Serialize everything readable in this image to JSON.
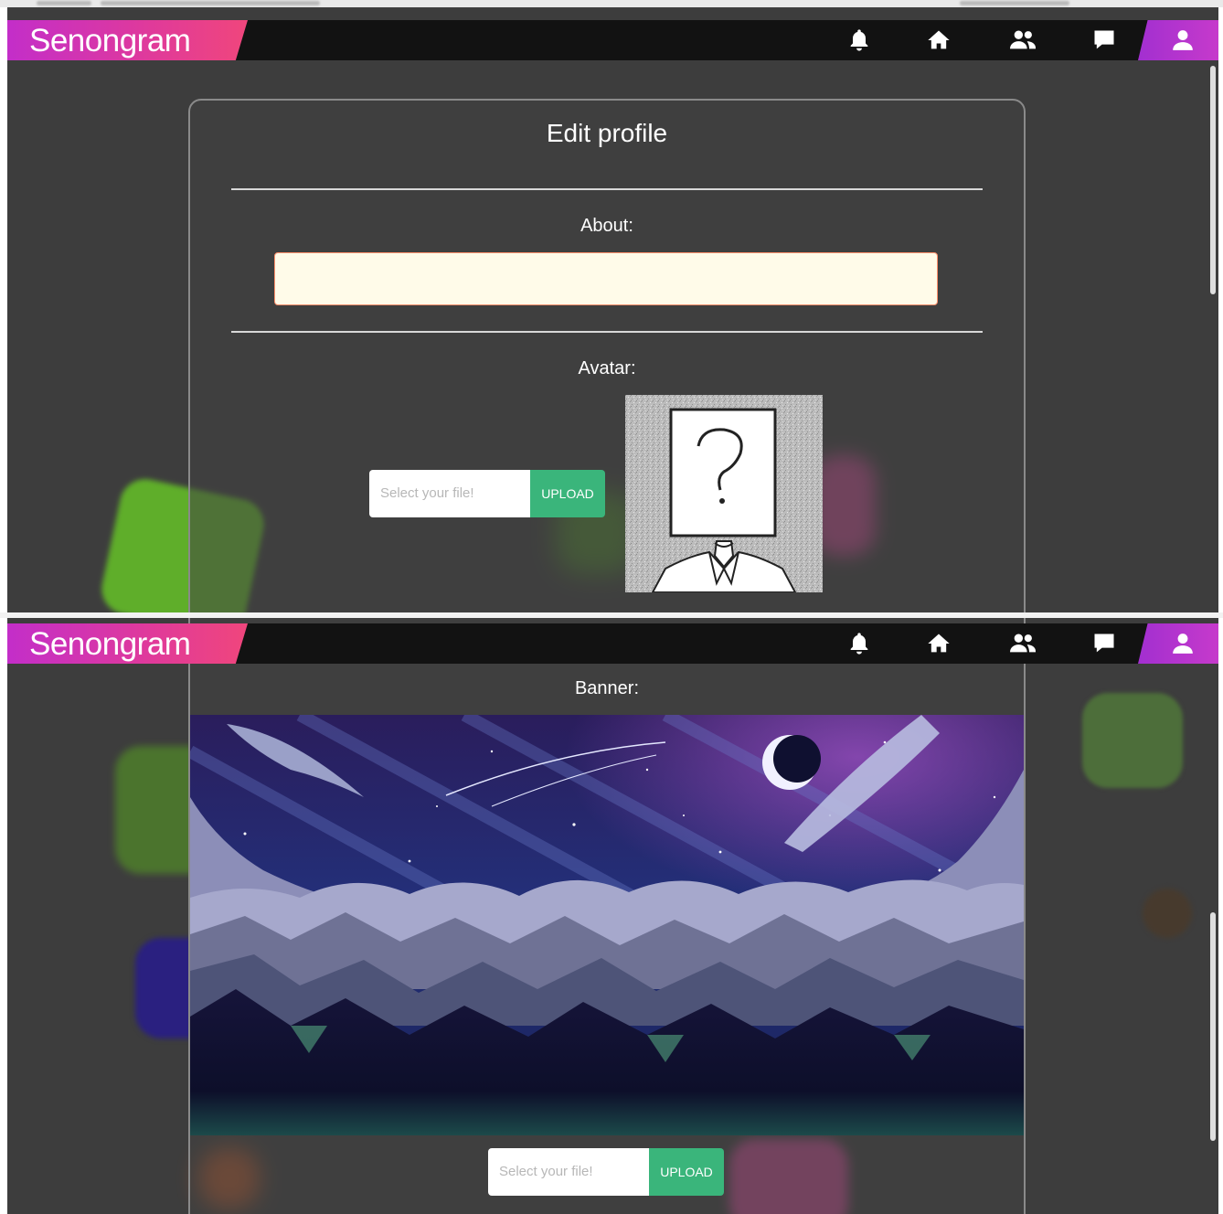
{
  "app": {
    "brand": "Senongram",
    "nav_icons": [
      "bell-icon",
      "home-icon",
      "users-icon",
      "chat-icon",
      "user-icon"
    ]
  },
  "profile": {
    "title": "Edit profile",
    "about_label": "About:",
    "about_value": "",
    "avatar_label": "Avatar:",
    "banner_label": "Banner:",
    "file_placeholder": "Select your file!",
    "upload_label": "UPLOAD"
  },
  "colors": {
    "brand_gradient_start": "#c32ec9",
    "brand_gradient_end": "#f0467c",
    "navbar": "#121212",
    "page_bg": "#3d3d3d",
    "upload_button": "#3ab57b",
    "about_input_bg": "#fffbe9"
  }
}
